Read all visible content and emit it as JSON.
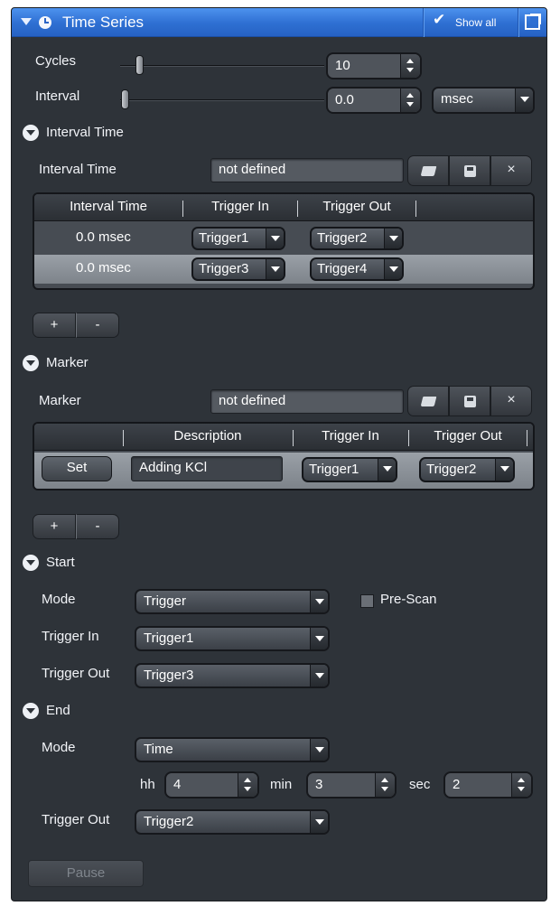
{
  "titlebar": {
    "title": "Time Series",
    "show_all_checked": true,
    "show_all_label": "Show all",
    "icon": "clock-icon"
  },
  "cycles": {
    "label": "Cycles",
    "value": "10"
  },
  "interval": {
    "label": "Interval",
    "value": "0.0",
    "unit": "msec"
  },
  "interval_time_section": {
    "header": "Interval Time",
    "field_label": "Interval Time",
    "field_value": "not defined",
    "columns": [
      "Interval Time",
      "Trigger In",
      "Trigger Out"
    ],
    "rows": [
      {
        "time": "0.0 msec",
        "trigger_in": "Trigger1",
        "trigger_out": "Trigger2",
        "selected": false
      },
      {
        "time": "0.0 msec",
        "trigger_in": "Trigger3",
        "trigger_out": "Trigger4",
        "selected": true
      }
    ],
    "add_label": "+",
    "remove_label": "-"
  },
  "marker_section": {
    "header": "Marker",
    "field_label": "Marker",
    "field_value": "not defined",
    "columns": [
      "Description",
      "Trigger In",
      "Trigger Out"
    ],
    "rows": [
      {
        "button": "Set",
        "description": "Adding  KCl",
        "trigger_in": "Trigger1",
        "trigger_out": "Trigger2"
      }
    ],
    "add_label": "+",
    "remove_label": "-"
  },
  "start_section": {
    "header": "Start",
    "mode_label": "Mode",
    "mode_value": "Trigger",
    "prescan_label": "Pre-Scan",
    "prescan_checked": false,
    "trigger_in_label": "Trigger In",
    "trigger_in_value": "Trigger1",
    "trigger_out_label": "Trigger Out",
    "trigger_out_value": "Trigger3"
  },
  "end_section": {
    "header": "End",
    "mode_label": "Mode",
    "mode_value": "Time",
    "hh_label": "hh",
    "hh_value": "4",
    "min_label": "min",
    "min_value": "3",
    "sec_label": "sec",
    "sec_value": "2",
    "trigger_out_label": "Trigger Out",
    "trigger_out_value": "Trigger2"
  },
  "pause_label": "Pause"
}
